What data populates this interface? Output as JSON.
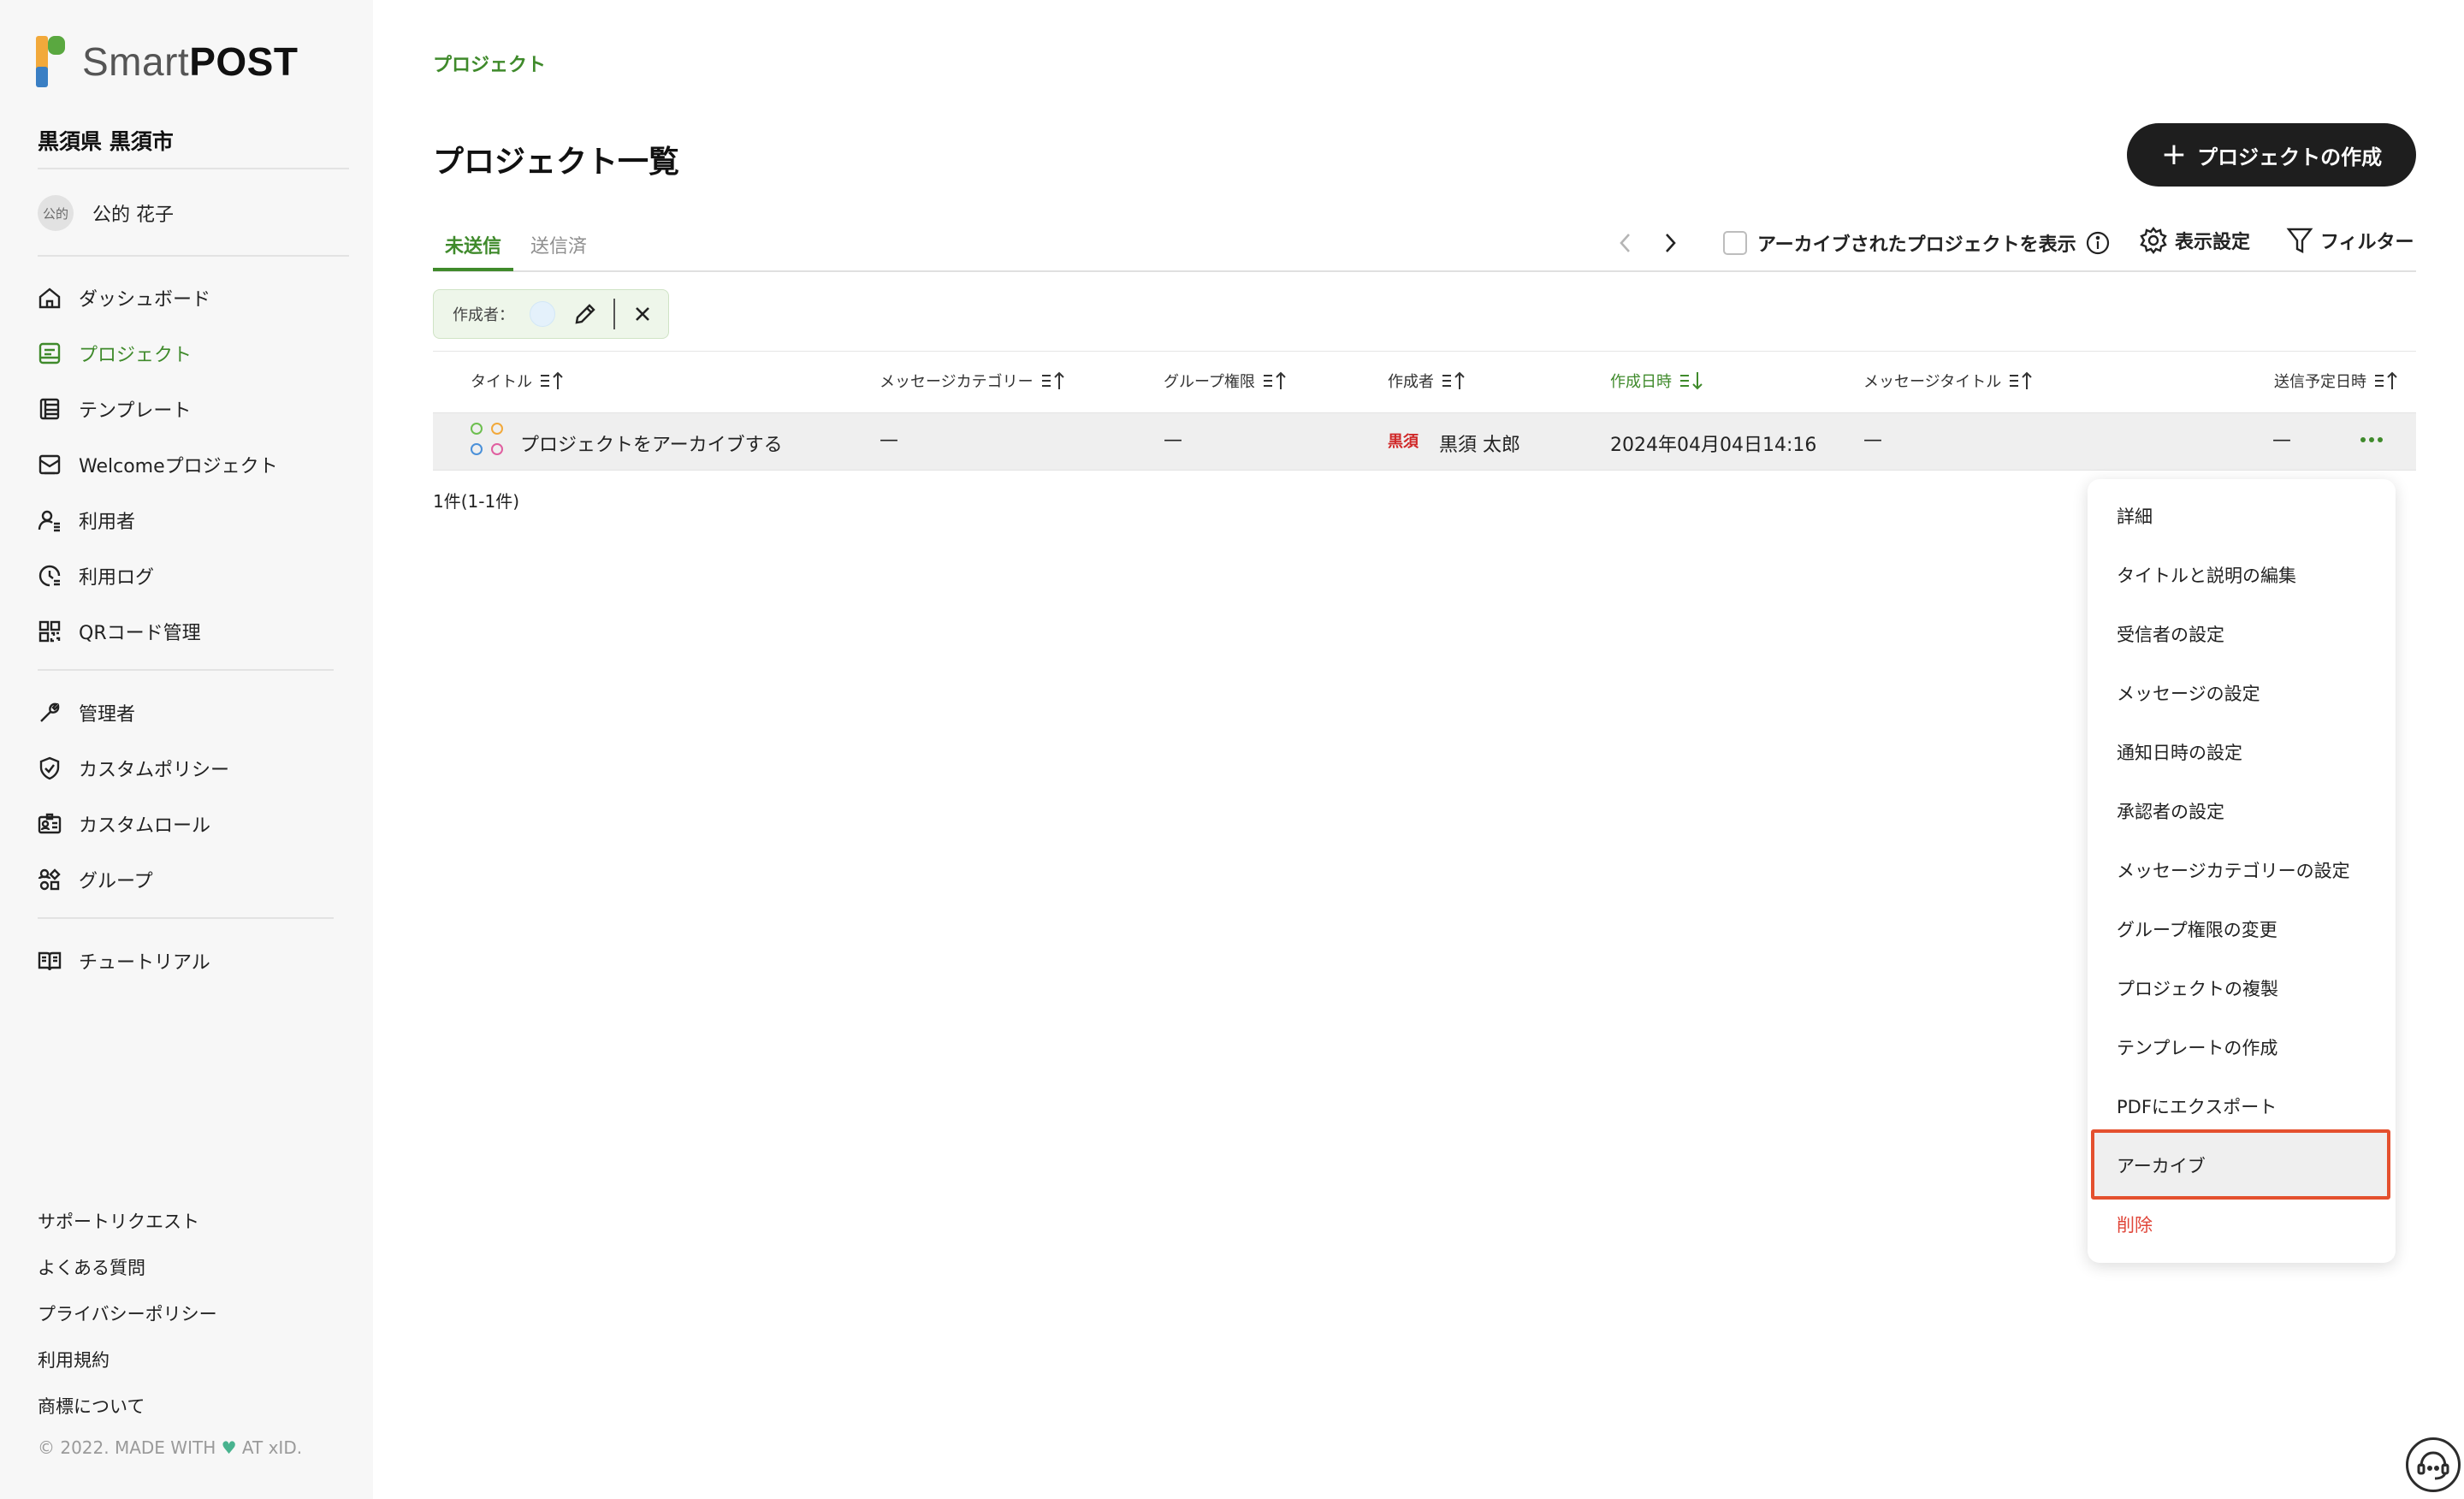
{
  "app": {
    "brand_light": "Smart",
    "brand_bold": "POST"
  },
  "sidebar": {
    "org_name": "黒須県 黒須市",
    "user": {
      "avatar_text": "公的",
      "name": "公的 花子"
    },
    "nav": [
      {
        "label": "ダッシュボード",
        "icon": "home-icon"
      },
      {
        "label": "プロジェクト",
        "icon": "project-icon",
        "active": true
      },
      {
        "label": "テンプレート",
        "icon": "template-icon"
      },
      {
        "label": "Welcomeプロジェクト",
        "icon": "welcome-mail-icon"
      },
      {
        "label": "利用者",
        "icon": "users-icon"
      },
      {
        "label": "利用ログ",
        "icon": "log-clock-icon"
      },
      {
        "label": "QRコード管理",
        "icon": "qr-code-icon"
      },
      {
        "label": "管理者",
        "icon": "wrench-icon"
      },
      {
        "label": "カスタムポリシー",
        "icon": "shield-check-icon"
      },
      {
        "label": "カスタムロール",
        "icon": "id-card-icon"
      },
      {
        "label": "グループ",
        "icon": "group-icon"
      },
      {
        "label": "チュートリアル",
        "icon": "book-icon"
      }
    ],
    "footer_links": [
      "サポートリクエスト",
      "よくある質問",
      "プライバシーポリシー",
      "利用規約",
      "商標について"
    ],
    "copyright_before": "© 2022. MADE WITH ",
    "copyright_after": " AT xID.",
    "heart_color": "#49b38f"
  },
  "main": {
    "breadcrumb": "プロジェクト",
    "title": "プロジェクト一覧",
    "create_button": "プロジェクトの作成",
    "tabs": [
      {
        "label": "未送信",
        "active": true
      },
      {
        "label": "送信済",
        "active": false
      }
    ],
    "archive_toggle_label": "アーカイブされたプロジェクトを表示",
    "display_settings": "表示設定",
    "filter": "フィルター",
    "filter_chip_label": "作成者：",
    "columns": [
      "タイトル",
      "メッセージカテゴリー",
      "グループ権限",
      "作成者",
      "作成日時",
      "メッセージタイトル",
      "送信予定日時"
    ],
    "sorted_column": "作成日時",
    "rows": [
      {
        "title": "プロジェクトをアーカイブする",
        "category": "—",
        "group_permission": "—",
        "creator_badge": "黒須",
        "creator": "黒須 太郎",
        "created_at": "2024年04月04日14:16",
        "message_title": "—",
        "scheduled": "—"
      }
    ],
    "count_text": "1件(1-1件)"
  },
  "context_menu": {
    "items": [
      "詳細",
      "タイトルと説明の編集",
      "受信者の設定",
      "メッセージの設定",
      "通知日時の設定",
      "承認者の設定",
      "メッセージカテゴリーの設定",
      "グループ権限の変更",
      "プロジェクトの複製",
      "テンプレートの作成",
      "PDFにエクスポート",
      "アーカイブ",
      "削除"
    ],
    "highlighted": "アーカイブ",
    "danger": "削除"
  },
  "colors": {
    "accent": "#3f8a2b",
    "danger": "#e0463a",
    "highlight_border": "#e4502e",
    "badge": "#d02828"
  }
}
